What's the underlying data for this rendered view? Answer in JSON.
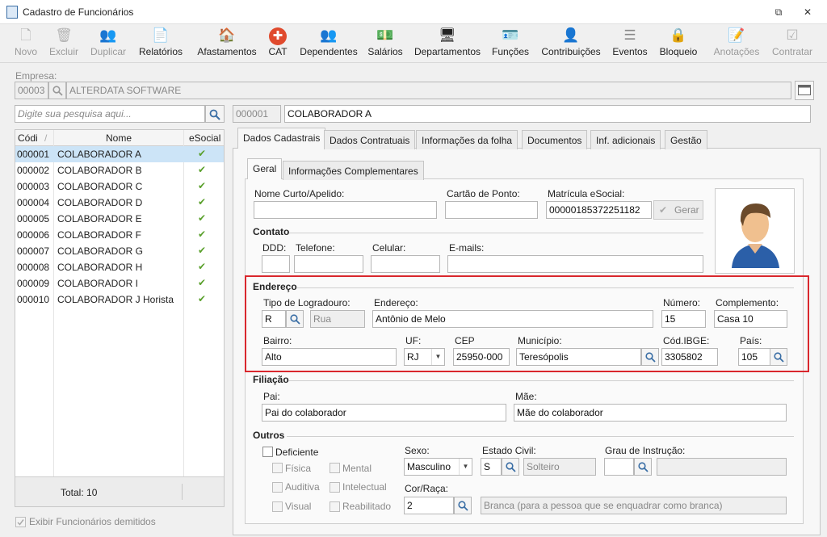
{
  "window": {
    "title": "Cadastro de Funcionários",
    "restore_glyph": "⧉",
    "close_glyph": "✕"
  },
  "toolbar": [
    {
      "label": "Novo",
      "icon": "new-doc-icon",
      "glyph": "🗋",
      "enabled": false
    },
    {
      "label": "Excluir",
      "icon": "trash-icon",
      "glyph": "🗑",
      "enabled": false
    },
    {
      "label": "Duplicar",
      "icon": "users-copy-icon",
      "glyph": "👥",
      "enabled": false
    },
    {
      "label": "Relatórios",
      "icon": "report-icon",
      "glyph": "📄",
      "enabled": true
    },
    {
      "label": "Afastamentos",
      "icon": "house-arrow-icon",
      "glyph": "🏠",
      "enabled": true
    },
    {
      "label": "CAT",
      "icon": "red-cross-icon",
      "glyph": "✚",
      "enabled": true
    },
    {
      "label": "Dependentes",
      "icon": "dependents-icon",
      "glyph": "👥",
      "enabled": true
    },
    {
      "label": "Salários",
      "icon": "money-icon",
      "glyph": "💵",
      "enabled": true
    },
    {
      "label": "Departamentos",
      "icon": "desk-icon",
      "glyph": "🖥",
      "enabled": true
    },
    {
      "label": "Funções",
      "icon": "badge-icon",
      "glyph": "🪪",
      "enabled": true
    },
    {
      "label": "Contribuições",
      "icon": "contrib-icon",
      "glyph": "👤",
      "enabled": true
    },
    {
      "label": "Eventos",
      "icon": "list-icon",
      "glyph": "☰",
      "enabled": true
    },
    {
      "label": "Bloqueio",
      "icon": "lock-icon",
      "glyph": "🔒",
      "enabled": true
    },
    {
      "label": "Anotações",
      "icon": "notes-icon",
      "glyph": "📝",
      "enabled": false
    },
    {
      "label": "Contratar",
      "icon": "hire-icon",
      "glyph": "☑",
      "enabled": false
    }
  ],
  "empresa": {
    "label": "Empresa:",
    "code": "00003",
    "name": "ALTERDATA SOFTWARE"
  },
  "search": {
    "placeholder": "Digite sua pesquisa aqui..."
  },
  "current": {
    "code": "000001",
    "name": "COLABORADOR A"
  },
  "grid": {
    "headers": [
      "Códi",
      "Nome",
      "eSocial"
    ],
    "rows": [
      {
        "code": "000001",
        "name": "COLABORADOR A",
        "esocial": "✔"
      },
      {
        "code": "000002",
        "name": "COLABORADOR B",
        "esocial": "✔"
      },
      {
        "code": "000003",
        "name": "COLABORADOR C",
        "esocial": "✔"
      },
      {
        "code": "000004",
        "name": "COLABORADOR D",
        "esocial": "✔"
      },
      {
        "code": "000005",
        "name": "COLABORADOR E",
        "esocial": "✔"
      },
      {
        "code": "000006",
        "name": "COLABORADOR F",
        "esocial": "✔"
      },
      {
        "code": "000007",
        "name": "COLABORADOR G",
        "esocial": "✔"
      },
      {
        "code": "000008",
        "name": "COLABORADOR H",
        "esocial": "✔"
      },
      {
        "code": "000009",
        "name": "COLABORADOR I",
        "esocial": "✔"
      },
      {
        "code": "000010",
        "name": "COLABORADOR J Horista",
        "esocial": "✔"
      }
    ],
    "total": "Total: 10"
  },
  "exibir_demitidos": "Exibir Funcionários demitidos",
  "tabs": [
    "Dados Cadastrais",
    "Dados Contratuais",
    "Informações da folha",
    "Documentos",
    "Inf. adicionais",
    "Gestão"
  ],
  "subtabs": [
    "Geral",
    "Informações Complementares"
  ],
  "form": {
    "nome_curto_label": "Nome Curto/Apelido:",
    "nome_curto": "",
    "cartao_label": "Cartão de Ponto:",
    "cartao": "",
    "matricula_label": "Matrícula eSocial:",
    "matricula": "00000185372251182",
    "gerar": "Gerar",
    "contato": "Contato",
    "ddd_label": "DDD:",
    "telefone_label": "Telefone:",
    "celular_label": "Celular:",
    "emails_label": "E-mails:",
    "endereco_section": "Endereço",
    "tipo_label": "Tipo de Logradouro:",
    "tipo_code": "R",
    "tipo_desc": "Rua",
    "endereco_label": "Endereço:",
    "endereco": "Antônio de Melo",
    "numero_label": "Número:",
    "numero": "15",
    "complemento_label": "Complemento:",
    "complemento": "Casa 10",
    "bairro_label": "Bairro:",
    "bairro": "Alto",
    "uf_label": "UF:",
    "uf": "RJ",
    "cep_label": "CEP",
    "cep": "25950-000",
    "municipio_label": "Município:",
    "municipio": "Teresópolis",
    "ibge_label": "Cód.IBGE:",
    "ibge": "3305802",
    "pais_label": "País:",
    "pais": "105",
    "filiacao": "Filiação",
    "pai_label": "Pai:",
    "pai": "Pai do colaborador",
    "mae_label": "Mãe:",
    "mae": "Mãe do colaborador",
    "outros": "Outros",
    "deficiente": "Deficiente",
    "fisica": "Física",
    "mental": "Mental",
    "auditiva": "Auditiva",
    "intelectual": "Intelectual",
    "visual": "Visual",
    "reabilitado": "Reabilitado",
    "sexo_label": "Sexo:",
    "sexo": "Masculino",
    "estado_civil_label": "Estado Civil:",
    "estado_civil_code": "S",
    "estado_civil_desc": "Solteiro",
    "grau_label": "Grau de Instrução:",
    "cor_label": "Cor/Raça:",
    "cor_code": "2",
    "cor_desc": "Branca (para a pessoa que se enquadrar como branca)"
  }
}
